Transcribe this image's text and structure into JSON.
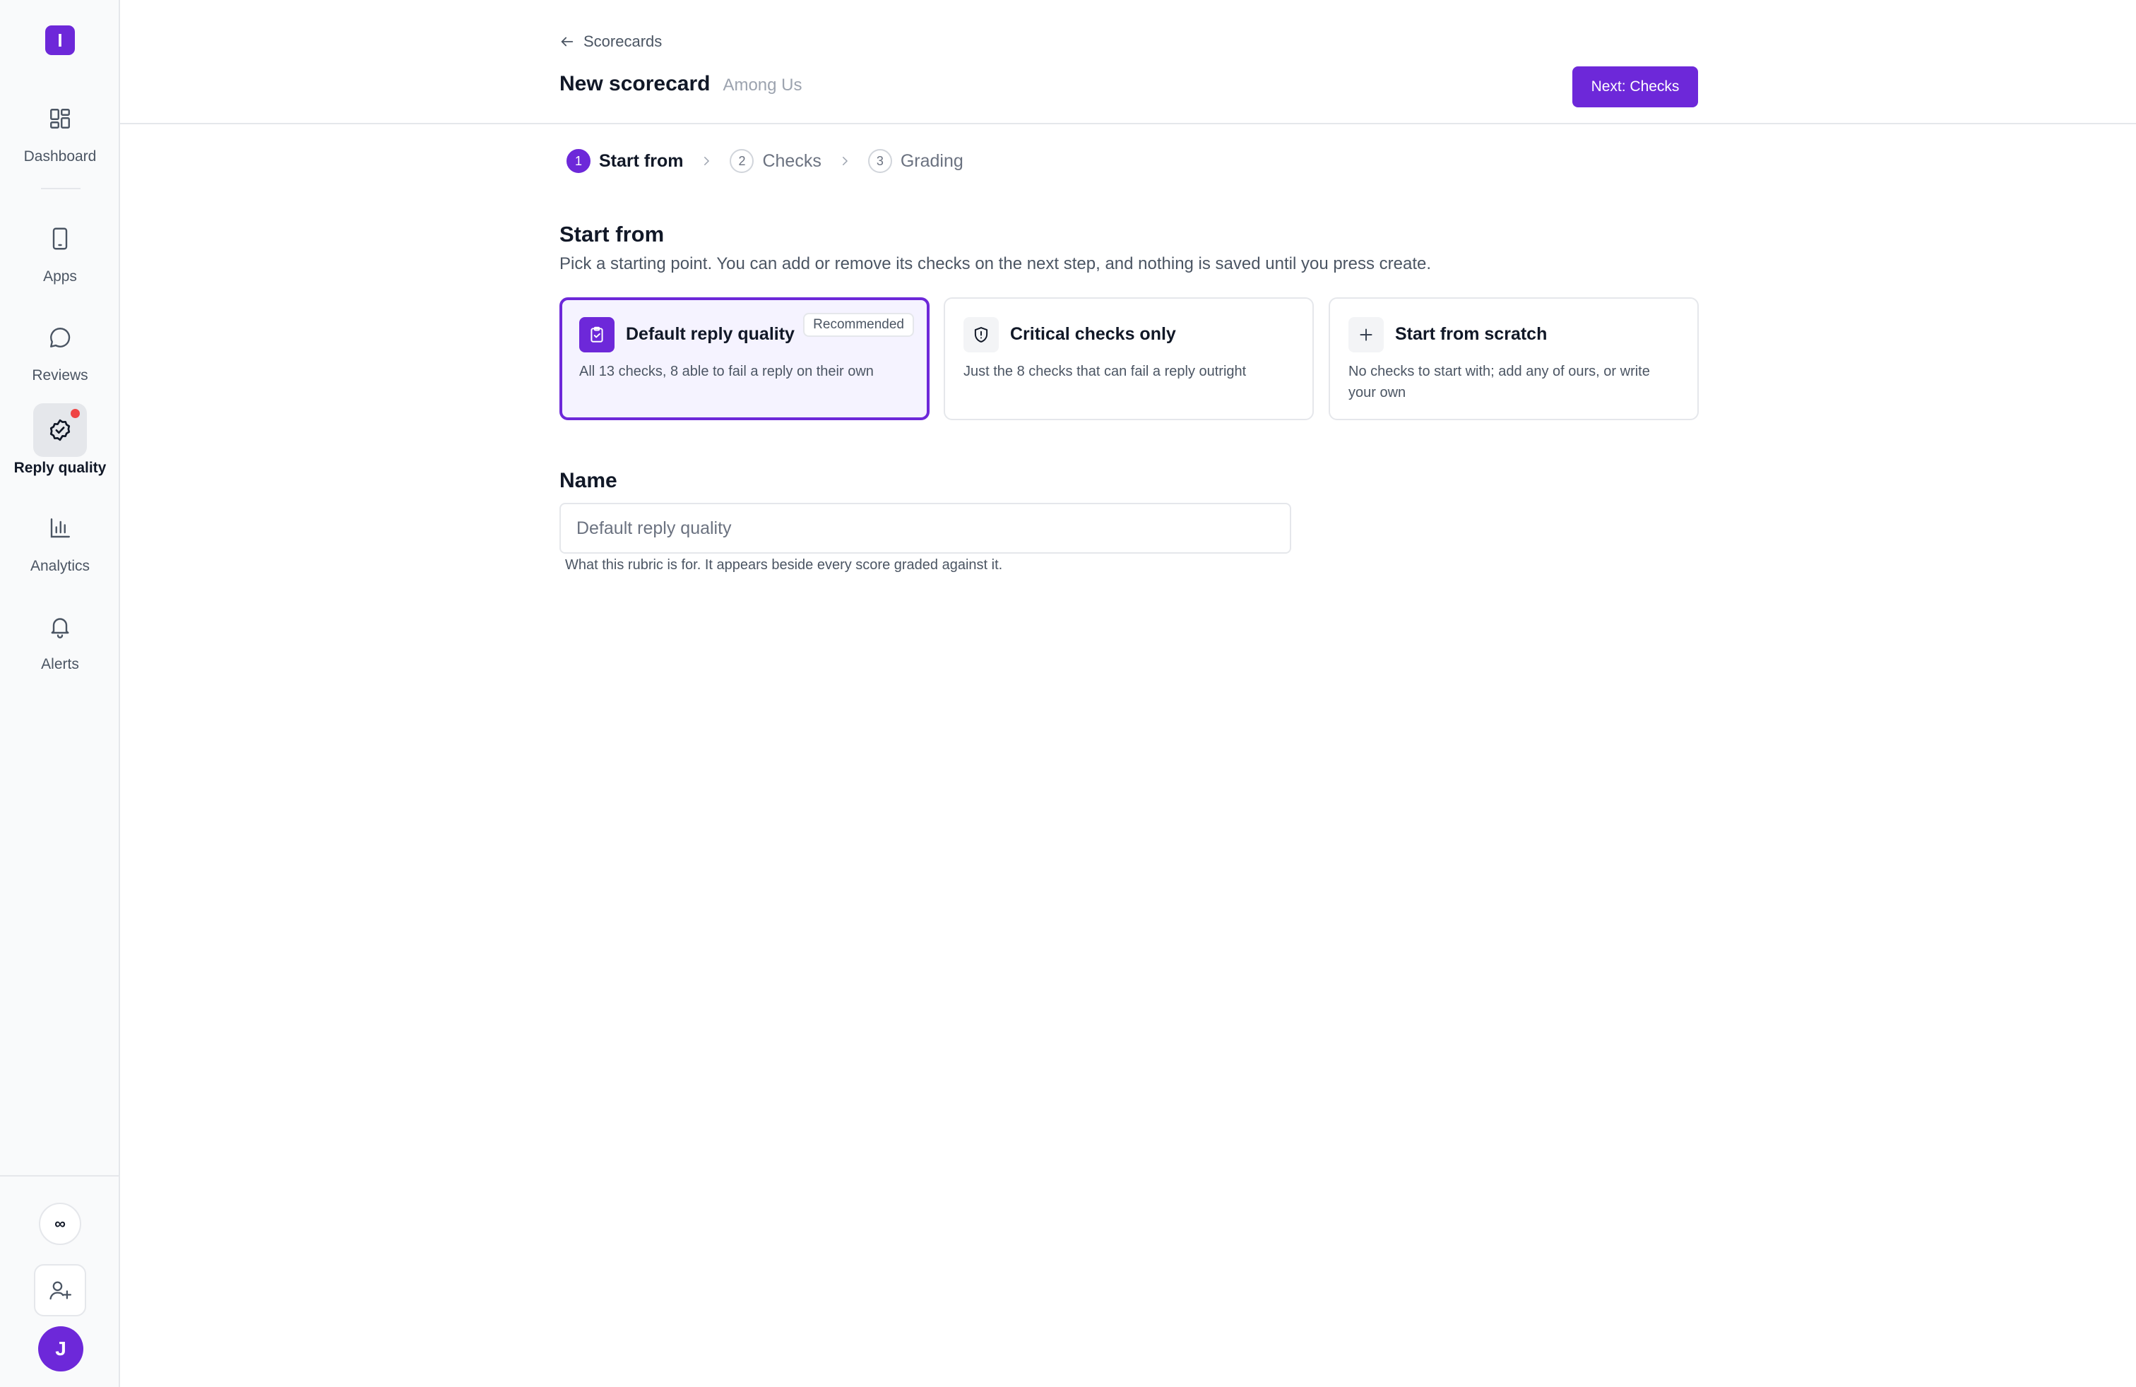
{
  "app": {
    "logo_letter": "I",
    "accent_color": "#6d28d9"
  },
  "sidebar": {
    "items": [
      {
        "label": "Dashboard",
        "icon": "dashboard-icon",
        "active": false
      },
      {
        "label": "Apps",
        "icon": "phone-icon",
        "active": false
      },
      {
        "label": "Reviews",
        "icon": "chat-bubble-icon",
        "active": false
      },
      {
        "label": "Reply quality",
        "icon": "badge-check-icon",
        "active": true,
        "notification": true
      },
      {
        "label": "Analytics",
        "icon": "bar-chart-icon",
        "active": false
      },
      {
        "label": "Alerts",
        "icon": "bell-icon",
        "active": false
      }
    ],
    "infinity_label": "∞",
    "invite_icon": "user-plus-icon",
    "avatar_initial": "J"
  },
  "header": {
    "breadcrumb": "Scorecards",
    "title": "New scorecard",
    "subtitle": "Among Us",
    "next_button": "Next: Checks"
  },
  "steps": [
    {
      "number": "1",
      "label": "Start from",
      "active": true
    },
    {
      "number": "2",
      "label": "Checks",
      "active": false
    },
    {
      "number": "3",
      "label": "Grading",
      "active": false
    }
  ],
  "start_from": {
    "title": "Start from",
    "description": "Pick a starting point. You can add or remove its checks on the next step, and nothing is saved until you press create.",
    "options": [
      {
        "title": "Default reply quality",
        "description": "All 13 checks, 8 able to fail a reply on their own",
        "badge": "Recommended",
        "icon": "clipboard-check-icon",
        "selected": true
      },
      {
        "title": "Critical checks only",
        "description": "Just the 8 checks that can fail a reply outright",
        "icon": "shield-icon",
        "selected": false
      },
      {
        "title": "Start from scratch",
        "description": "No checks to start with; add any of ours, or write your own",
        "icon": "plus-icon",
        "selected": false
      }
    ]
  },
  "name_field": {
    "label": "Name",
    "placeholder": "Default reply quality",
    "help": "What this rubric is for. It appears beside every score graded against it."
  }
}
